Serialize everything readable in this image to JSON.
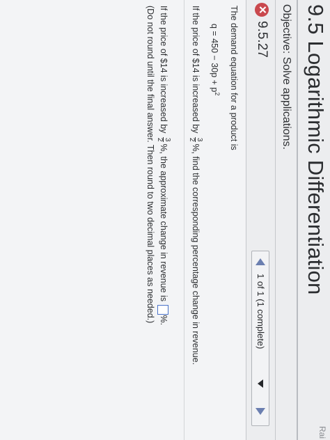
{
  "header": {
    "title": "9.5 Logarithmic Differentiation",
    "corner_text": "Rai",
    "objective": "Objective: Solve applications."
  },
  "question_bar": {
    "number": "9.5.27",
    "status_icon": "incorrect-x-icon",
    "status_color": "#c9484d",
    "progress": "1 of 1 (1 complete)"
  },
  "problem": {
    "intro": "The demand equation for a product is",
    "equation": "q = 450 − 30p + p",
    "equation_exponent": "2",
    "question_pre": "If the price of $14 is increased by",
    "frac_num": "3",
    "frac_den": "2",
    "question_post": "%, find the corresponding percentage change in revenue.",
    "answer_pre": "If the price of $14 is increased by",
    "answer_mid": "%, the approximate change in revenue is",
    "answer_post": "%.",
    "note": "(Do not round until the final answer. Then round to two decimal places as needed.)"
  }
}
